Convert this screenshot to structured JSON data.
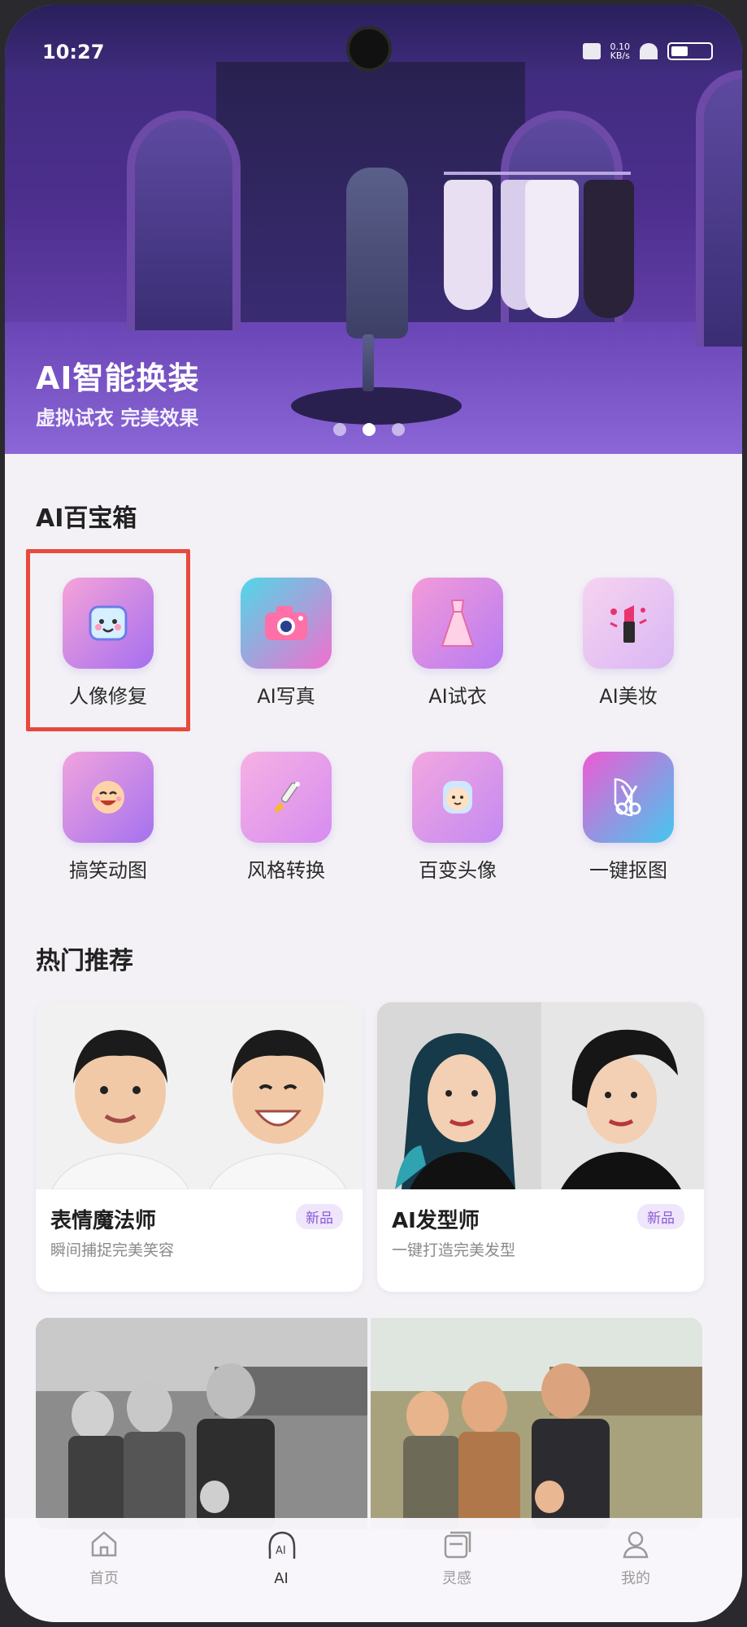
{
  "status_bar": {
    "time": "10:27",
    "net_speed_value": "0.10",
    "net_speed_unit": "KB/s"
  },
  "hero": {
    "title": "AI智能换装",
    "subtitle": "虚拟试衣 完美效果",
    "pager": {
      "count": 3,
      "active_index": 1
    }
  },
  "toolbox": {
    "title": "AI百宝箱",
    "tools": [
      {
        "label": "人像修复",
        "icon": "face-emoji-icon"
      },
      {
        "label": "AI写真",
        "icon": "camera-icon"
      },
      {
        "label": "AI试衣",
        "icon": "dress-icon"
      },
      {
        "label": "AI美妆",
        "icon": "lipstick-icon"
      },
      {
        "label": "搞笑动图",
        "icon": "laughing-face-icon"
      },
      {
        "label": "风格转换",
        "icon": "paintbrush-icon"
      },
      {
        "label": "百变头像",
        "icon": "baby-face-icon"
      },
      {
        "label": "一键抠图",
        "icon": "scissors-icon"
      }
    ]
  },
  "recommendations": {
    "title": "热门推荐",
    "cards": [
      {
        "name": "表情魔法师",
        "desc": "瞬间捕捉完美笑容",
        "badge": "新品"
      },
      {
        "name": "AI发型师",
        "desc": "一键打造完美发型",
        "badge": "新品"
      }
    ]
  },
  "bottom_nav": {
    "items": [
      {
        "label": "首页",
        "icon": "home-icon"
      },
      {
        "label": "AI",
        "icon": "ai-head-icon",
        "active": true
      },
      {
        "label": "灵感",
        "icon": "cards-icon"
      },
      {
        "label": "我的",
        "icon": "user-icon"
      }
    ]
  },
  "colors": {
    "highlight": "#e8493d",
    "accent": "#8a5ad6"
  }
}
